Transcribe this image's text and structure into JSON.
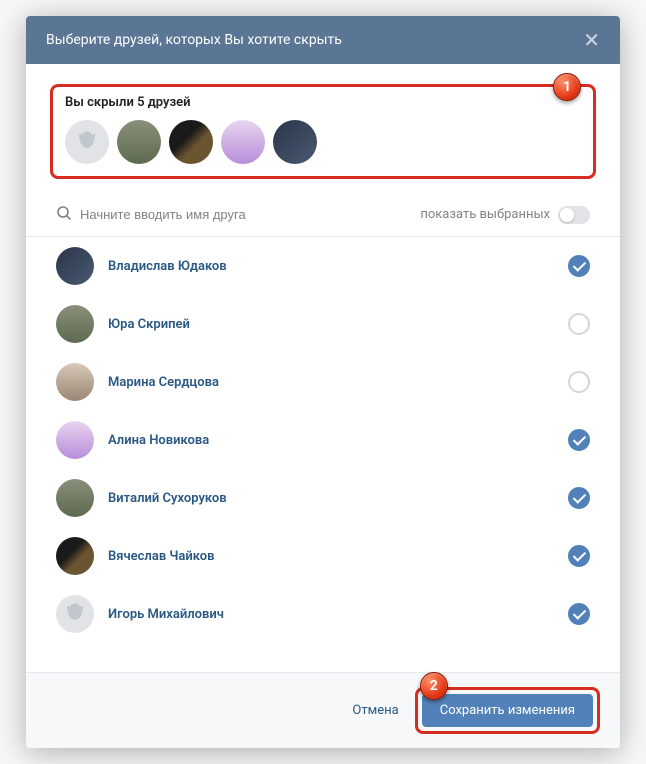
{
  "header": {
    "title": "Выберите друзей, которых Вы хотите скрыть"
  },
  "hidden": {
    "title": "Вы скрыли 5 друзей",
    "badge": "1"
  },
  "search": {
    "placeholder": "Начните вводить имя друга",
    "show_selected_label": "показать выбранных"
  },
  "friends": [
    {
      "name": "Владислав Юдаков",
      "selected": true
    },
    {
      "name": "Юра Скрипей",
      "selected": false
    },
    {
      "name": "Марина Сердцова",
      "selected": false
    },
    {
      "name": "Алина Новикова",
      "selected": true
    },
    {
      "name": "Виталий Сухоруков",
      "selected": true
    },
    {
      "name": "Вячеслав Чайков",
      "selected": true
    },
    {
      "name": "Игорь Михайлович",
      "selected": true
    }
  ],
  "footer": {
    "cancel": "Отмена",
    "save": "Сохранить изменения",
    "badge": "2"
  },
  "avatar_styles": [
    "av-dog",
    "av-color1",
    "av-color2",
    "av-color3",
    "av-color4"
  ],
  "friend_avatar_styles": [
    "av-color4",
    "av-color1",
    "av-color6",
    "av-color3",
    "av-color1",
    "av-color2",
    "av-dog"
  ]
}
